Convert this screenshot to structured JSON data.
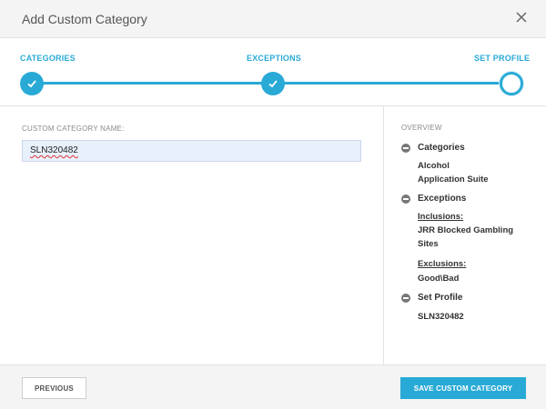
{
  "dialog": {
    "title": "Add Custom Category",
    "close_icon": "close-icon"
  },
  "stepper": {
    "steps": [
      {
        "label": "CATEGORIES",
        "state": "complete",
        "icon": "check-icon"
      },
      {
        "label": "EXCEPTIONS",
        "state": "complete",
        "icon": "check-icon"
      },
      {
        "label": "SET PROFILE",
        "state": "current",
        "icon": "current-step-icon"
      }
    ],
    "accent_color": "#29aad6"
  },
  "form": {
    "name_label": "CUSTOM CATEGORY NAME:",
    "name_value": "SLN320482"
  },
  "overview": {
    "title": "OVERVIEW",
    "categories": {
      "label": "Categories",
      "items": [
        "Alcohol",
        "Application Suite"
      ]
    },
    "exceptions": {
      "label": "Exceptions",
      "inclusions_label": "Inclusions:",
      "inclusions_line1": "JRR Blocked Gambling",
      "inclusions_line2": "Sites",
      "exclusions_label": "Exclusions:",
      "exclusions_value": "Good\\Bad"
    },
    "set_profile": {
      "label": "Set Profile",
      "value": "SLN320482"
    }
  },
  "footer": {
    "previous_label": "PREVIOUS",
    "save_label": "SAVE CUSTOM CATEGORY"
  }
}
